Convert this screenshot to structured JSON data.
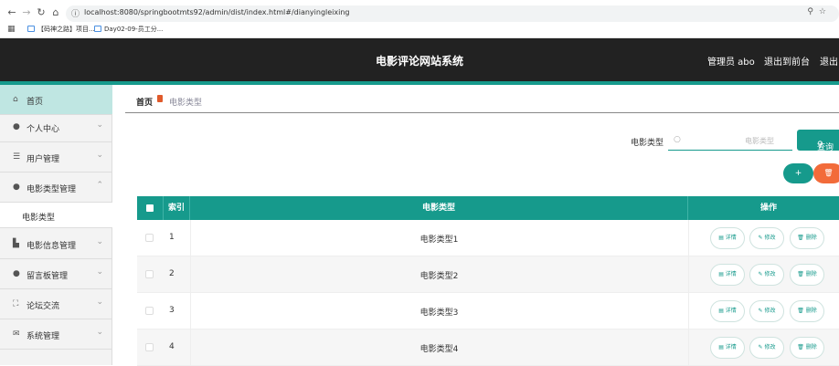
{
  "browser": {
    "url": "localhost:8080/springbootmts92/admin/dist/index.html#/dianyingleixing",
    "bookmarks": [
      "【码神之路】项目...",
      "Day02-09-员工分..."
    ]
  },
  "header": {
    "title": "电影评论网站系统",
    "admin": "管理员 abo",
    "to_front": "退出到前台",
    "logout": "退出"
  },
  "sidebar": {
    "items": [
      {
        "label": "首页",
        "icon": "home-icon"
      },
      {
        "label": "个人中心",
        "icon": "user-icon"
      },
      {
        "label": "用户管理",
        "icon": "list-icon"
      },
      {
        "label": "电影类型管理",
        "icon": "user-icon"
      },
      {
        "label": "电影信息管理",
        "icon": "chart-icon"
      },
      {
        "label": "留言板管理",
        "icon": "user-icon"
      },
      {
        "label": "论坛交流",
        "icon": "frame-icon"
      },
      {
        "label": "系统管理",
        "icon": "mail-icon"
      }
    ],
    "sub_item": "电影类型"
  },
  "breadcrumb": {
    "home": "首页",
    "current": "电影类型"
  },
  "search": {
    "label": "电影类型",
    "placeholder": "电影类型",
    "button": "查询"
  },
  "actions": {
    "add": "+",
    "delete": "🗑"
  },
  "table": {
    "headers": [
      "索引",
      "电影类型",
      "操作"
    ],
    "rows": [
      {
        "index": "1",
        "type": "电影类型1"
      },
      {
        "index": "2",
        "type": "电影类型2"
      },
      {
        "index": "3",
        "type": "电影类型3"
      },
      {
        "index": "4",
        "type": "电影类型4"
      }
    ],
    "op_labels": {
      "view": "详情",
      "edit": "修改",
      "delete": "删除"
    }
  },
  "colors": {
    "accent": "#169a8c",
    "danger": "#f26b3a",
    "header_bg": "#222222"
  }
}
